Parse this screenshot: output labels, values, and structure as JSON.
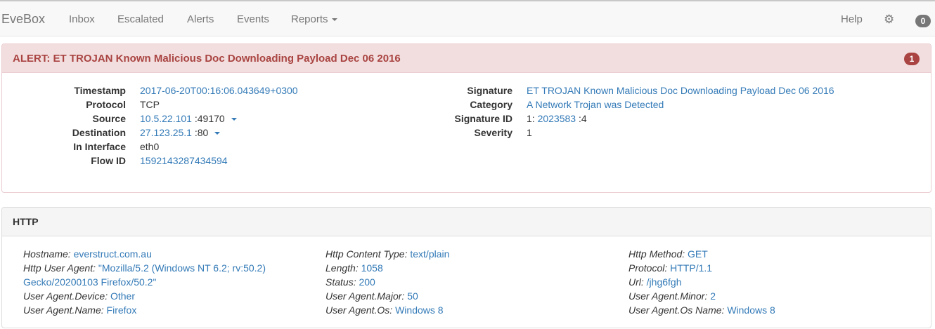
{
  "navbar": {
    "brand": "EveBox",
    "items": [
      "Inbox",
      "Escalated",
      "Alerts",
      "Events"
    ],
    "reports": "Reports",
    "help": "Help",
    "count": "0"
  },
  "alert": {
    "title": "ALERT: ET TROJAN Known Malicious Doc Downloading Payload Dec 06 2016",
    "badge": "1",
    "left": {
      "timestamp_label": "Timestamp",
      "timestamp": "2017-06-20T00:16:06.043649+0300",
      "protocol_label": "Protocol",
      "protocol": "TCP",
      "source_label": "Source",
      "source_ip": "10.5.22.101",
      "source_port": ":49170",
      "destination_label": "Destination",
      "destination_ip": "27.123.25.1",
      "destination_port": ":80",
      "interface_label": "In Interface",
      "interface": "eth0",
      "flow_label": "Flow ID",
      "flow_id": "1592143287434594"
    },
    "right": {
      "signature_label": "Signature",
      "signature": "ET TROJAN Known Malicious Doc Downloading Payload Dec 06 2016",
      "category_label": "Category",
      "category": "A Network Trojan was Detected",
      "sigid_label": "Signature ID",
      "sigid_gid": "1:",
      "sigid_sid": "2023583",
      "sigid_rev": ":4",
      "severity_label": "Severity",
      "severity": "1"
    }
  },
  "http": {
    "title": "HTTP",
    "col1": [
      {
        "key": "Hostname:",
        "value": "everstruct.com.au"
      },
      {
        "key": "Http User Agent:",
        "value": "\"Mozilla/5.2 (Windows NT 6.2; rv:50.2)"
      },
      {
        "key": "",
        "value": "Gecko/20200103 Firefox/50.2\""
      },
      {
        "key": "User Agent.Device:",
        "value": "Other"
      },
      {
        "key": "User Agent.Name:",
        "value": "Firefox"
      }
    ],
    "col2": [
      {
        "key": "Http Content Type:",
        "value": "text/plain"
      },
      {
        "key": "Length:",
        "value": "1058"
      },
      {
        "key": "Status:",
        "value": "200"
      },
      {
        "key": "User Agent.Major:",
        "value": "50"
      },
      {
        "key": "User Agent.Os:",
        "value": "Windows 8"
      }
    ],
    "col3": [
      {
        "key": "Http Method:",
        "value": "GET"
      },
      {
        "key": "Protocol:",
        "value": "HTTP/1.1"
      },
      {
        "key": "Url:",
        "value": "/jhg6fgh"
      },
      {
        "key": "User Agent.Minor:",
        "value": "2"
      },
      {
        "key": "User Agent.Os Name:",
        "value": "Windows 8"
      }
    ]
  }
}
